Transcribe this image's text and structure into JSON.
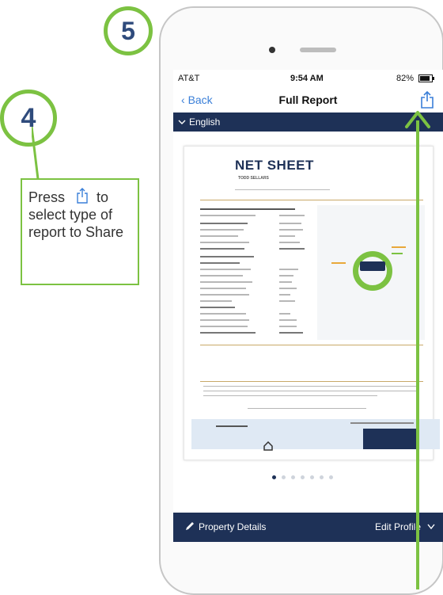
{
  "steps": {
    "four": "4",
    "five": "5"
  },
  "callout": {
    "line1": "Press",
    "line2": "to select type of report to Share"
  },
  "status": {
    "carrier": "AT&T",
    "time": "9:54 AM",
    "battery": "82%"
  },
  "nav": {
    "back": "Back",
    "title": "Full Report"
  },
  "language": {
    "selected": "English"
  },
  "document": {
    "title": "NET SHEET",
    "subtitle": "TODD SELLARS"
  },
  "footer": {
    "property_details": "Property Details",
    "edit_profile": "Edit Profile"
  },
  "pager": {
    "pages": 7,
    "active_index": 0
  },
  "colors": {
    "accent_green": "#7cc242",
    "navy": "#1e3157",
    "link_blue": "#3a7fd8"
  },
  "icons": {
    "share": "share-icon",
    "chevron_down": "chevron-down-icon",
    "back_chevron": "chevron-left-icon",
    "pencil": "pencil-icon"
  }
}
